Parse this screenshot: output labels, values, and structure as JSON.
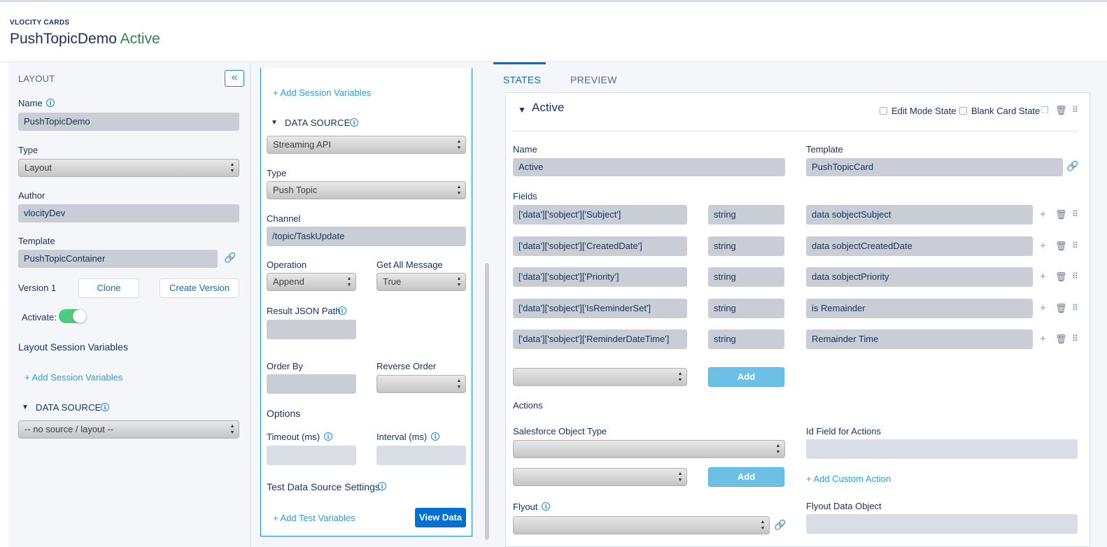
{
  "header": {
    "app_label": "VLOCITY CARDS",
    "title": "PushTopicDemo",
    "status": "Active"
  },
  "left": {
    "section_title": "LAYOUT",
    "collapse_icon": "double-chevron-left-icon",
    "name_label": "Name",
    "name_value": "PushTopicDemo",
    "type_label": "Type",
    "type_value": "Layout",
    "author_label": "Author",
    "author_value": "vlocityDev",
    "template_label": "Template",
    "template_value": "PushTopicContainer",
    "version_label": "Version 1",
    "clone_label": "Clone",
    "create_version_label": "Create Version",
    "activate_label": "Activate:",
    "activate_on": true,
    "session_vars_title": "Layout Session Variables",
    "add_session_vars": "+ Add Session Variables",
    "data_source_title": "DATA SOURCE",
    "data_source_value": "-- no source / layout --"
  },
  "middle": {
    "add_session_vars": "+ Add Session Variables",
    "data_source_title": "DATA SOURCE",
    "data_source_value": "Streaming API",
    "type_label": "Type",
    "type_value": "Push Topic",
    "channel_label": "Channel",
    "channel_value": "/topic/TaskUpdate",
    "operation_label": "Operation",
    "operation_value": "Append",
    "get_all_label": "Get All Message",
    "get_all_value": "True",
    "result_path_label": "Result JSON Path",
    "order_by_label": "Order By",
    "reverse_order_label": "Reverse Order",
    "options_title": "Options",
    "timeout_label": "Timeout (ms)",
    "interval_label": "Interval (ms)",
    "test_settings_title": "Test Data Source Settings",
    "add_test_vars": "+ Add Test Variables",
    "view_data_label": "View Data"
  },
  "right": {
    "tabs": [
      {
        "label": "STATES",
        "active": true
      },
      {
        "label": "PREVIEW",
        "active": false
      }
    ],
    "state_title": "Active",
    "edit_mode_label": "Edit Mode State",
    "blank_card_label": "Blank Card State",
    "name_label": "Name",
    "name_value": "Active",
    "template_label": "Template",
    "template_value": "PushTopicCard",
    "fields_label": "Fields",
    "fields": [
      {
        "path": "['data']['sobject']['Subject']",
        "type": "string",
        "label": "data sobjectSubject"
      },
      {
        "path": "['data']['sobject']['CreatedDate']",
        "type": "string",
        "label": "data sobjectCreatedDate"
      },
      {
        "path": "['data']['sobject']['Priority']",
        "type": "string",
        "label": "data sobjectPriority"
      },
      {
        "path": "['data']['sobject']['IsReminderSet']",
        "type": "string",
        "label": "is Remainder"
      },
      {
        "path": "['data']['sobject']['ReminderDateTime']",
        "type": "string",
        "label": "Remainder Time"
      }
    ],
    "add_label": "Add",
    "actions_label": "Actions",
    "sf_object_label": "Salesforce Object Type",
    "id_field_label": "Id Field for Actions",
    "add_custom_action": "+ Add Custom Action",
    "flyout_label": "Flyout",
    "flyout_data_label": "Flyout Data Object"
  },
  "colors": {
    "accent": "#0070d2",
    "active_status": "#2e844a",
    "toggle_on": "#4bca81",
    "add_button": "#6cc0e5"
  }
}
